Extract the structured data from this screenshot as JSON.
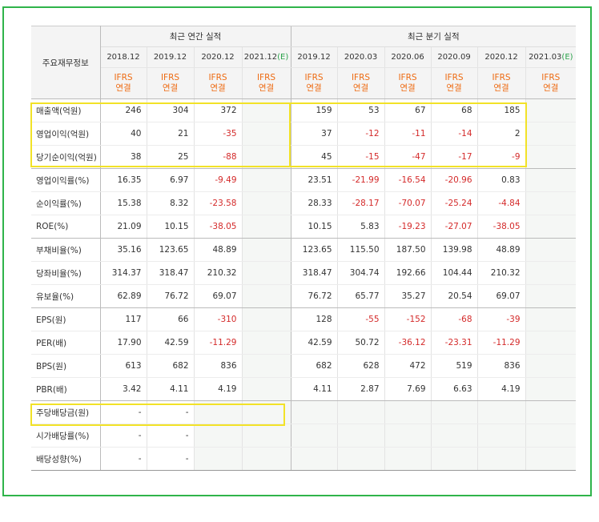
{
  "header": {
    "row_label": "주요재무정보",
    "annual_title": "최근 연간 실적",
    "quarterly_title": "최근 분기 실적",
    "annual_periods": [
      {
        "label": "2018.12",
        "est": ""
      },
      {
        "label": "2019.12",
        "est": ""
      },
      {
        "label": "2020.12",
        "est": ""
      },
      {
        "label": "2021.12",
        "est": "(E)"
      }
    ],
    "quarterly_periods": [
      {
        "label": "2019.12",
        "est": ""
      },
      {
        "label": "2020.03",
        "est": ""
      },
      {
        "label": "2020.06",
        "est": ""
      },
      {
        "label": "2020.09",
        "est": ""
      },
      {
        "label": "2020.12",
        "est": ""
      },
      {
        "label": "2021.03",
        "est": "(E)"
      }
    ],
    "ifrs_line1": "IFRS",
    "ifrs_line2": "연결"
  },
  "rows": [
    {
      "label": "매출액(억원)",
      "annual": [
        "246",
        "304",
        "372",
        ""
      ],
      "quarterly": [
        "159",
        "53",
        "67",
        "68",
        "185",
        ""
      ]
    },
    {
      "label": "영업이익(억원)",
      "annual": [
        "40",
        "21",
        "-35",
        ""
      ],
      "quarterly": [
        "37",
        "-12",
        "-11",
        "-14",
        "2",
        ""
      ]
    },
    {
      "label": "당기순이익(억원)",
      "annual": [
        "38",
        "25",
        "-88",
        ""
      ],
      "quarterly": [
        "45",
        "-15",
        "-47",
        "-17",
        "-9",
        ""
      ]
    },
    {
      "label": "영업이익률(%)",
      "annual": [
        "16.35",
        "6.97",
        "-9.49",
        ""
      ],
      "quarterly": [
        "23.51",
        "-21.99",
        "-16.54",
        "-20.96",
        "0.83",
        ""
      ]
    },
    {
      "label": "순이익률(%)",
      "annual": [
        "15.38",
        "8.32",
        "-23.58",
        ""
      ],
      "quarterly": [
        "28.33",
        "-28.17",
        "-70.07",
        "-25.24",
        "-4.84",
        ""
      ]
    },
    {
      "label": "ROE(%)",
      "annual": [
        "21.09",
        "10.15",
        "-38.05",
        ""
      ],
      "quarterly": [
        "10.15",
        "5.83",
        "-19.23",
        "-27.07",
        "-38.05",
        ""
      ]
    },
    {
      "label": "부채비율(%)",
      "annual": [
        "35.16",
        "123.65",
        "48.89",
        ""
      ],
      "quarterly": [
        "123.65",
        "115.50",
        "187.50",
        "139.98",
        "48.89",
        ""
      ]
    },
    {
      "label": "당좌비율(%)",
      "annual": [
        "314.37",
        "318.47",
        "210.32",
        ""
      ],
      "quarterly": [
        "318.47",
        "304.74",
        "192.66",
        "104.44",
        "210.32",
        ""
      ]
    },
    {
      "label": "유보율(%)",
      "annual": [
        "62.89",
        "76.72",
        "69.07",
        ""
      ],
      "quarterly": [
        "76.72",
        "65.77",
        "35.27",
        "20.54",
        "69.07",
        ""
      ]
    },
    {
      "label": "EPS(원)",
      "annual": [
        "117",
        "66",
        "-310",
        ""
      ],
      "quarterly": [
        "128",
        "-55",
        "-152",
        "-68",
        "-39",
        ""
      ]
    },
    {
      "label": "PER(배)",
      "annual": [
        "17.90",
        "42.59",
        "-11.29",
        ""
      ],
      "quarterly": [
        "42.59",
        "50.72",
        "-36.12",
        "-23.31",
        "-11.29",
        ""
      ]
    },
    {
      "label": "BPS(원)",
      "annual": [
        "613",
        "682",
        "836",
        ""
      ],
      "quarterly": [
        "682",
        "628",
        "472",
        "519",
        "836",
        ""
      ]
    },
    {
      "label": "PBR(배)",
      "annual": [
        "3.42",
        "4.11",
        "4.19",
        ""
      ],
      "quarterly": [
        "4.11",
        "2.87",
        "7.69",
        "6.63",
        "4.19",
        ""
      ]
    },
    {
      "label": "주당배당금(원)",
      "annual": [
        "-",
        "-",
        "",
        ""
      ],
      "quarterly": [
        "",
        "",
        "",
        "",
        "",
        ""
      ]
    },
    {
      "label": "시가배당률(%)",
      "annual": [
        "-",
        "-",
        "",
        ""
      ],
      "quarterly": [
        "",
        "",
        "",
        "",
        "",
        ""
      ]
    },
    {
      "label": "배당성향(%)",
      "annual": [
        "-",
        "-",
        "",
        ""
      ],
      "quarterly": [
        "",
        "",
        "",
        "",
        "",
        ""
      ]
    }
  ],
  "colors": {
    "frame": "#2fb44a",
    "highlight": "#f2e227",
    "negative": "#d42a2a",
    "ifrs": "#ee6b13",
    "estimate_mark": "#2aa24a"
  }
}
